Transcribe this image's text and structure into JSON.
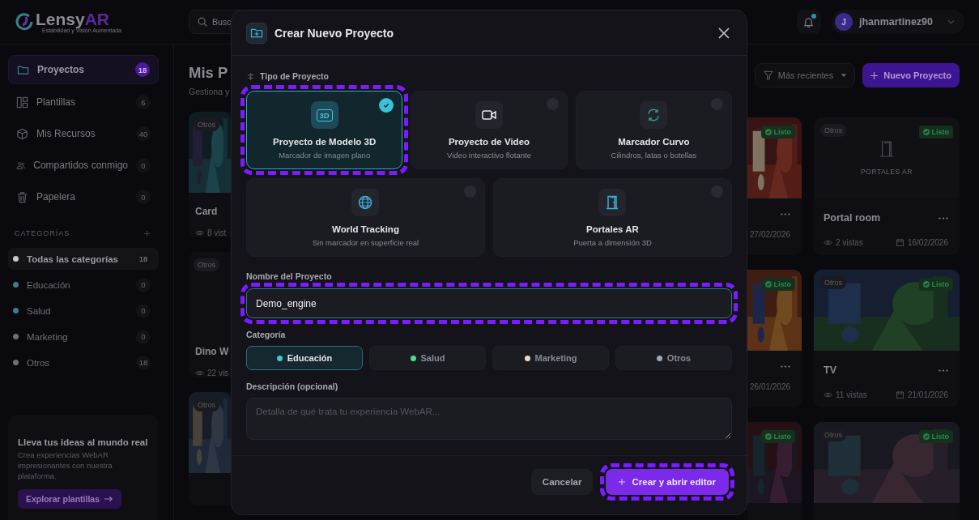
{
  "header": {
    "logo_main": "Lensy",
    "logo_accent": "AR",
    "tagline": "Estabilidad y Visión Aumentada",
    "search": {
      "placeholder": "Busc"
    },
    "notifications": {
      "unread": true
    },
    "user": {
      "initial": "J",
      "name": "jhanmartinez90"
    }
  },
  "sidebar": {
    "items": [
      {
        "kind": "folder",
        "label": "Proyectos",
        "count": "18",
        "selected": true
      },
      {
        "kind": "layout",
        "label": "Plantillas",
        "count": "6",
        "selected": false
      },
      {
        "kind": "box",
        "label": "Mis Recursos",
        "count": "40",
        "selected": false
      },
      {
        "kind": "users",
        "label": "Compartidos conmigo",
        "count": "0",
        "selected": false
      },
      {
        "kind": "trash",
        "label": "Papelera",
        "count": "0",
        "selected": false
      }
    ],
    "categories_title": "CATEGORÍAS",
    "categories": [
      {
        "label": "Todas las categorías",
        "count": "18",
        "color": "#c8c8cc",
        "selected": true
      },
      {
        "label": "Educación",
        "count": "0",
        "color": "#3a7f8a",
        "selected": false
      },
      {
        "label": "Salud",
        "count": "0",
        "color": "#3a7f8a",
        "selected": false
      },
      {
        "label": "Marketing",
        "count": "0",
        "color": "#6e6e74",
        "selected": false
      },
      {
        "label": "Otros",
        "count": "18",
        "color": "#6e6e74",
        "selected": false
      }
    ],
    "promo": {
      "title": "Lleva tus ideas al mundo real",
      "text": "Crea experiencias WebAR impresionantes con nuestra plataforma.",
      "button": "Explorar plantillas"
    }
  },
  "main": {
    "title": "Mis P",
    "subtitle": "Gestiona y",
    "sort": "Más recientes",
    "new_button": "Nuevo Proyecto",
    "left_cards": [
      {
        "kind": "picture",
        "badge": "Otros",
        "title": "Card",
        "views": "8 vist"
      },
      {
        "kind": "plain",
        "badge": "Otros",
        "title": "Dino W",
        "views": "22 vis"
      },
      {
        "kind": "picture",
        "badge": "Otros"
      }
    ],
    "partial_cards": [
      {
        "kind": "picture",
        "status": "Listo",
        "date": "27/02/2026"
      },
      {
        "kind": "picture",
        "status": "Listo",
        "date": "26/01/2026"
      },
      {
        "kind": "picture",
        "status": "Listo"
      }
    ],
    "cards": [
      {
        "kind": "placeholder",
        "placeholder_label": "PORTALES AR",
        "badge": "Otros",
        "status": "Listo",
        "title": "Portal room",
        "views": "2 vistas",
        "date": "16/02/2026"
      },
      {
        "kind": "picture",
        "badge": "Otros",
        "status": "Listo",
        "title": "TV",
        "views": "11 vistas",
        "date": "21/01/2026"
      },
      {
        "kind": "picture",
        "badge": "Otros",
        "status": "Listo"
      }
    ]
  },
  "modal": {
    "title": "Crear Nuevo Proyecto",
    "type_label": "Tipo de Proyecto",
    "types": [
      {
        "kind": "model3d",
        "icon_label": "3D",
        "title": "Proyecto de Modelo 3D",
        "subtitle": "Marcador de imagen plano",
        "selected": true,
        "highlighted": true
      },
      {
        "kind": "video",
        "title": "Proyecto de Video",
        "subtitle": "Video interactivo flotante",
        "selected": false,
        "highlighted": false
      },
      {
        "kind": "curve",
        "title": "Marcador Curvo",
        "subtitle": "Cilindros, latas o botellas",
        "selected": false,
        "highlighted": false
      },
      {
        "kind": "globe",
        "title": "World Tracking",
        "subtitle": "Sin marcador en superficie real",
        "selected": false,
        "highlighted": false
      },
      {
        "kind": "door",
        "title": "Portales AR",
        "subtitle": "Puerta a dimensión 3D",
        "selected": false,
        "highlighted": false
      }
    ],
    "name_label": "Nombre del Proyecto",
    "name_value": "Demo_engine",
    "name_highlighted": true,
    "category_label": "Categoría",
    "categories": [
      {
        "label": "Educación",
        "color": "#3cc8e0",
        "selected": true
      },
      {
        "label": "Salud",
        "color": "#4ade80",
        "selected": false
      },
      {
        "label": "Marketing",
        "color": "#ead8c6",
        "selected": false
      },
      {
        "label": "Otros",
        "color": "#9aa9b5",
        "selected": false
      }
    ],
    "description_label": "Descripción (opcional)",
    "description_placeholder": "Detalla de qué trata tu experiencia WebAR...",
    "cancel": "Cancelar",
    "create": "Crear y abrir editor",
    "create_highlighted": true
  }
}
